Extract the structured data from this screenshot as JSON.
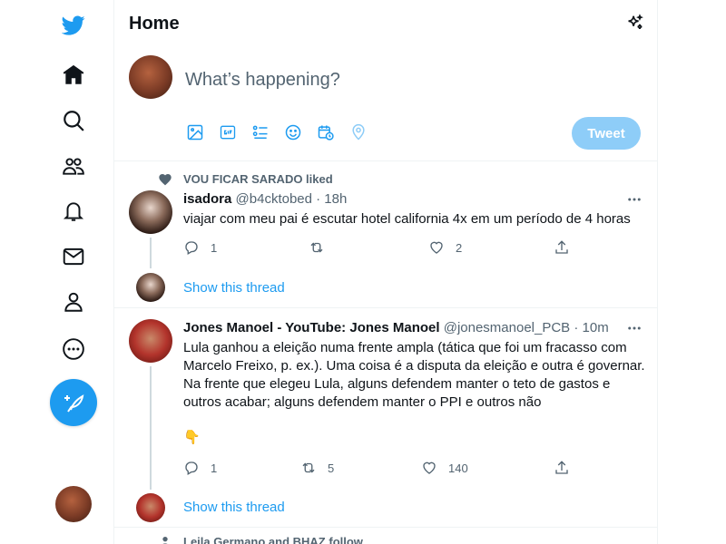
{
  "header": {
    "title": "Home"
  },
  "composer": {
    "placeholder": "What’s happening?",
    "tweet_label": "Tweet"
  },
  "tweets": [
    {
      "social_context": "VOU FICAR SARADO liked",
      "display_name": "isadora",
      "handle_time": "@b4cktobed · 18h",
      "text": "viajar com meu pai é escutar hotel california 4x em um período de 4 horas",
      "replies": "1",
      "retweets": "",
      "likes": "2",
      "show_thread": "Show this thread"
    },
    {
      "social_context": "",
      "display_name": "Jones Manoel - YouTube: Jones Manoel",
      "handle_time": "@jonesmanoel_PCB · 10m",
      "text_lines": [
        "Lula ganhou a eleição numa frente ampla (tática que foi um fracasso com",
        "Marcelo Freixo, p. ex.). Uma coisa é a disputa da eleição e outra é governar.",
        "Na frente que elegeu Lula, alguns defendem manter o teto de gastos e",
        "outros acabar; alguns defendem manter o PPI e outros não"
      ],
      "emoji": "👇",
      "replies": "1",
      "retweets": "5",
      "likes": "140",
      "show_thread": "Show this thread"
    }
  ],
  "next_context": "Leila Germano and BHAZ follow",
  "colors": {
    "accent": "#1d9bf0",
    "tweet_button_disabled": "#8ecdf8",
    "secondary_text": "#536471"
  }
}
